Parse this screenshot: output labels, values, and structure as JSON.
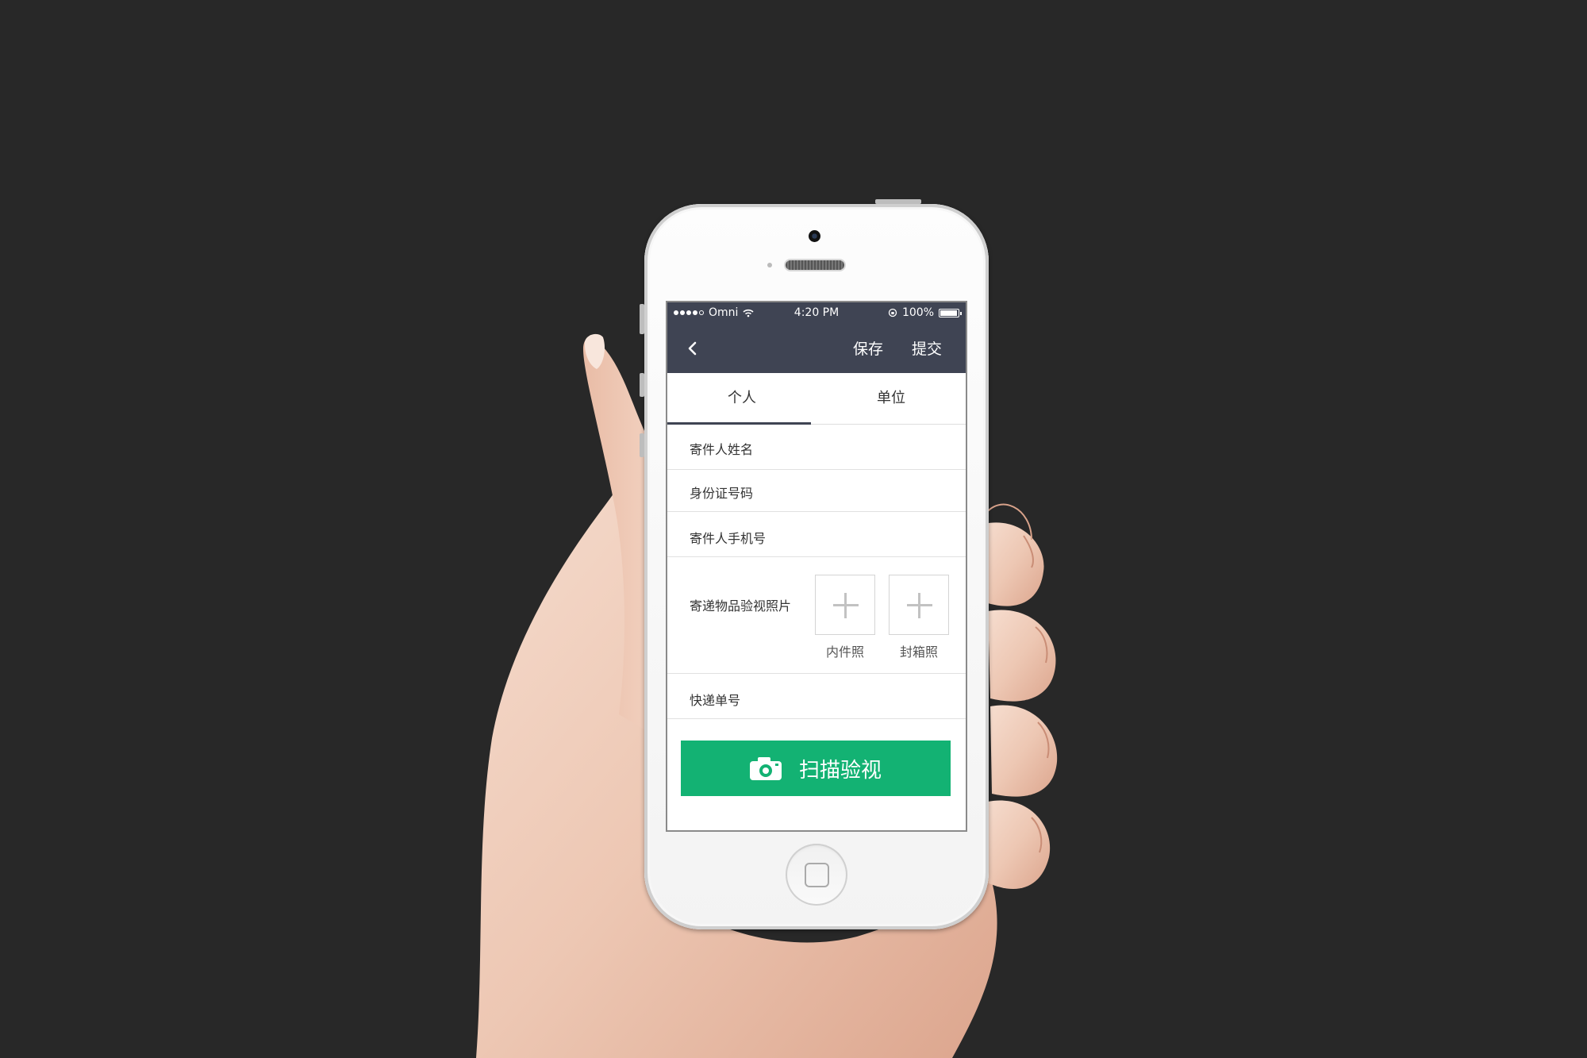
{
  "status_bar": {
    "carrier": "Omni",
    "time": "4:20 PM",
    "battery_percent": "100%"
  },
  "nav": {
    "save_label": "保存",
    "submit_label": "提交",
    "back_icon": "chevron-left-icon"
  },
  "tabs": [
    {
      "label": "个人",
      "active": true
    },
    {
      "label": "单位",
      "active": false
    }
  ],
  "form": {
    "sender_name_label": "寄件人姓名",
    "id_number_label": "身份证号码",
    "sender_phone_label": "寄件人手机号",
    "photo_label": "寄递物品验视照片",
    "photos": [
      {
        "caption": "内件照"
      },
      {
        "caption": "封箱照"
      }
    ],
    "tracking_label": "快递单号"
  },
  "scan_button": {
    "label": "扫描验视",
    "icon": "camera-icon",
    "color": "#13b273"
  },
  "colors": {
    "header": "#3f4453",
    "background": "#282828"
  }
}
